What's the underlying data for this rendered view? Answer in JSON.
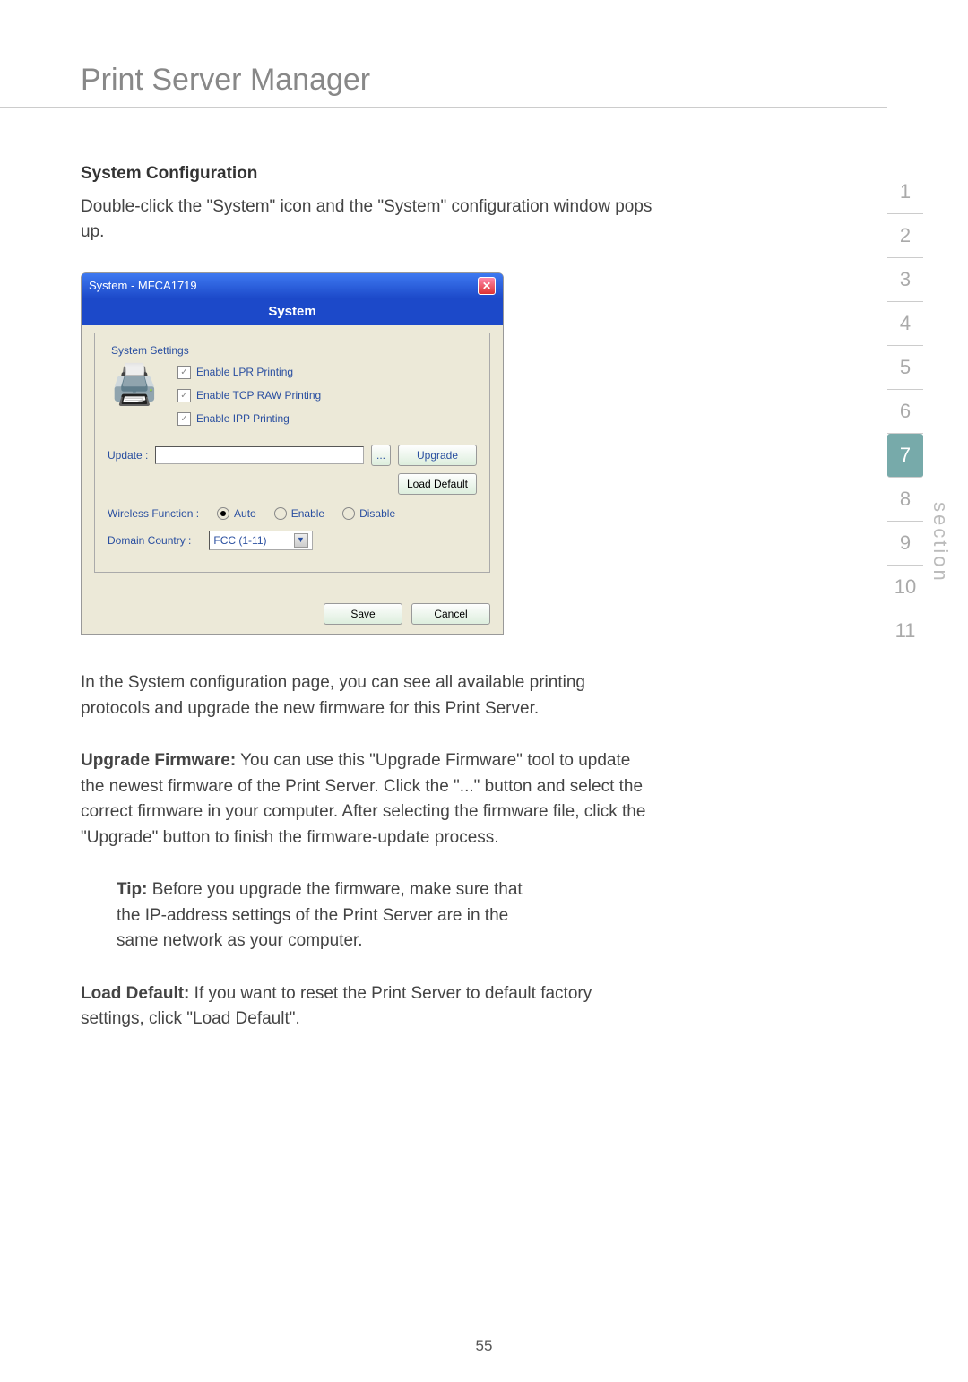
{
  "page_title": "Print Server Manager",
  "subheading": "System Configuration",
  "intro_text": "Double-click the \"System\" icon and the \"System\" configuration window pops up.",
  "dialog": {
    "title": "System - MFCA1719",
    "header": "System",
    "fieldset_legend": "System Settings",
    "checks": [
      {
        "label": "Enable LPR Printing",
        "checked": true
      },
      {
        "label": "Enable TCP RAW Printing",
        "checked": true
      },
      {
        "label": "Enable IPP Printing",
        "checked": true
      }
    ],
    "update_label": "Update :",
    "browse_btn": "...",
    "upgrade_btn": "Upgrade",
    "load_default_btn": "Load Default",
    "wireless_label": "Wireless Function :",
    "radios": [
      {
        "label": "Auto",
        "selected": true
      },
      {
        "label": "Enable",
        "selected": false
      },
      {
        "label": "Disable",
        "selected": false
      }
    ],
    "domain_label": "Domain Country :",
    "domain_value": "FCC (1-11)",
    "save_btn": "Save",
    "cancel_btn": "Cancel"
  },
  "para1": "In the System configuration page, you can see all available printing protocols and upgrade the new firmware for this Print Server.",
  "upgrade_bold": "Upgrade Firmware:",
  "upgrade_text": " You can use this \"Upgrade Firmware\" tool to update the newest firmware of the Print Server. Click the \"...\" button and select the correct firmware in your computer. After selecting the firmware file, click the \"Upgrade\" button to finish the firmware-update process.",
  "tip_bold": "Tip:",
  "tip_text": " Before you upgrade the firmware, make sure that the IP-address settings of the Print Server are in the same network as your computer.",
  "loaddef_bold": "Load Default:",
  "loaddef_text": " If you want to reset the Print Server to default factory settings, click \"Load Default\".",
  "page_number": "55",
  "sections": [
    "1",
    "2",
    "3",
    "4",
    "5",
    "6",
    "7",
    "8",
    "9",
    "10",
    "11"
  ],
  "active_section_index": 6,
  "side_label": "section"
}
